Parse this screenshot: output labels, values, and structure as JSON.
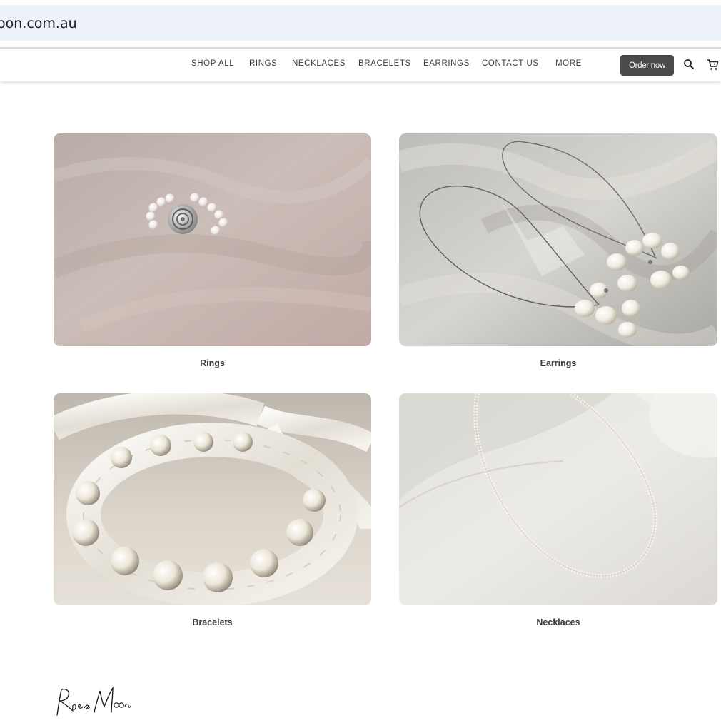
{
  "browser": {
    "url_visible": "oon.com.au"
  },
  "nav": {
    "items": [
      {
        "label": "SHOP ALL"
      },
      {
        "label": "RINGS"
      },
      {
        "label": "NECKLACES"
      },
      {
        "label": "BRACELETS"
      },
      {
        "label": "EARRINGS"
      },
      {
        "label": "CONTACT US"
      },
      {
        "label": "MORE"
      }
    ],
    "order_button": "Order now",
    "icons": [
      "search-icon",
      "cart-icon"
    ]
  },
  "categories": [
    {
      "label": "Rings",
      "image": "pearl-rose-ring-photo"
    },
    {
      "label": "Earrings",
      "image": "pearl-cluster-earrings-photo"
    },
    {
      "label": "Bracelets",
      "image": "pearl-satin-bracelet-photo"
    },
    {
      "label": "Necklaces",
      "image": "seed-pearl-necklace-photo"
    }
  ],
  "colors": {
    "button_bg": "#4a4a4a",
    "url_bar_bg": "#edf2fa",
    "text": "#3a3a3a"
  }
}
